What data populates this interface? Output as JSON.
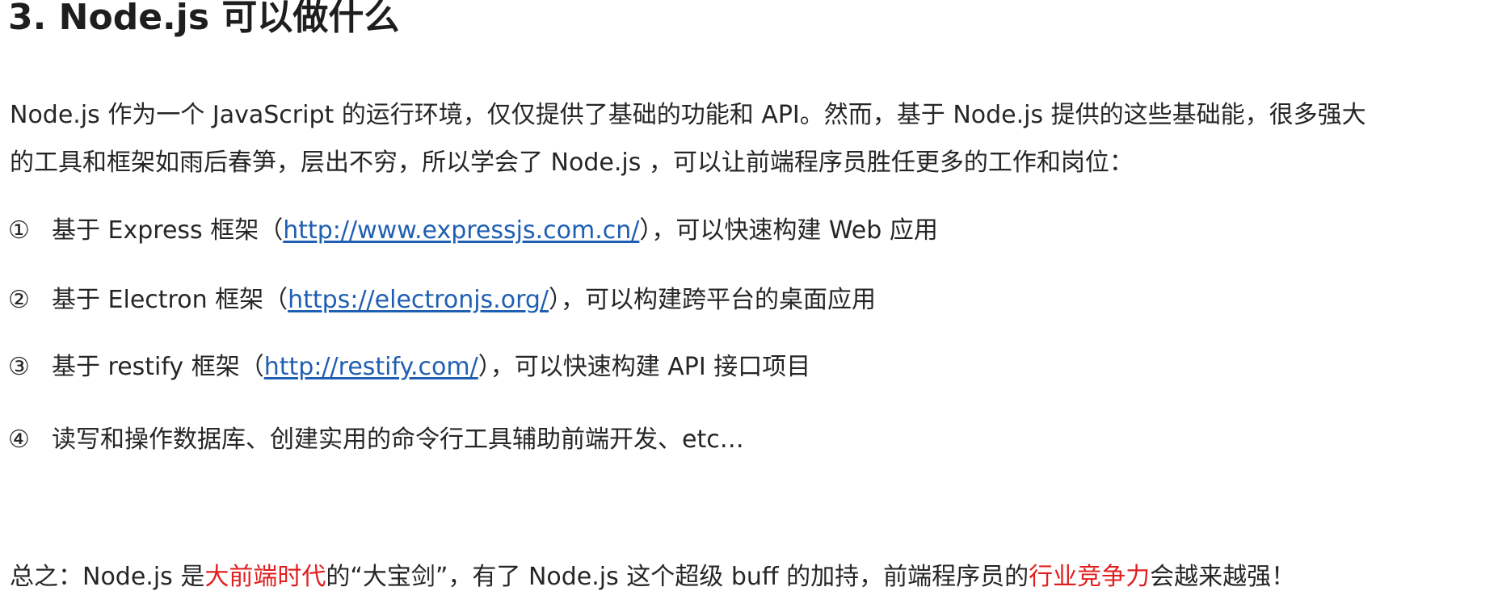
{
  "heading": "3. Node.js 可以做什么",
  "intro": {
    "line1": "Node.js 作为一个 JavaScript 的运行环境，仅仅提供了基础的功能和 API。然而，基于 Node.js 提供的这些基础能，很多强大",
    "line2": "的工具和框架如雨后春笋，层出不穷，所以学会了 Node.js ，可以让前端程序员胜任更多的工作和岗位："
  },
  "items": [
    {
      "num": "①",
      "before": "基于 Express 框架（",
      "link": "http://www.expressjs.com.cn/",
      "after": "），可以快速构建 Web 应用"
    },
    {
      "num": "②",
      "before": "基于 Electron 框架（",
      "link": "https://electronjs.org/",
      "after": "），可以构建跨平台的桌面应用"
    },
    {
      "num": "③",
      "before": "基于 restify 框架（",
      "link": "http://restify.com/",
      "after": "），可以快速构建 API 接口项目"
    },
    {
      "num": "④",
      "text": "读写和操作数据库、创建实用的命令行工具辅助前端开发、etc…"
    }
  ],
  "summary": {
    "part1": "总之：Node.js 是",
    "highlight1": "大前端时代",
    "part2": "的“大宝剑”，有了 Node.js 这个超级 buff 的加持，前端程序员的",
    "highlight2": "行业竞争力",
    "part3": "会越来越强！"
  },
  "colors": {
    "link": "#1f5fb3",
    "highlight": "#e02020",
    "text": "#262626"
  }
}
